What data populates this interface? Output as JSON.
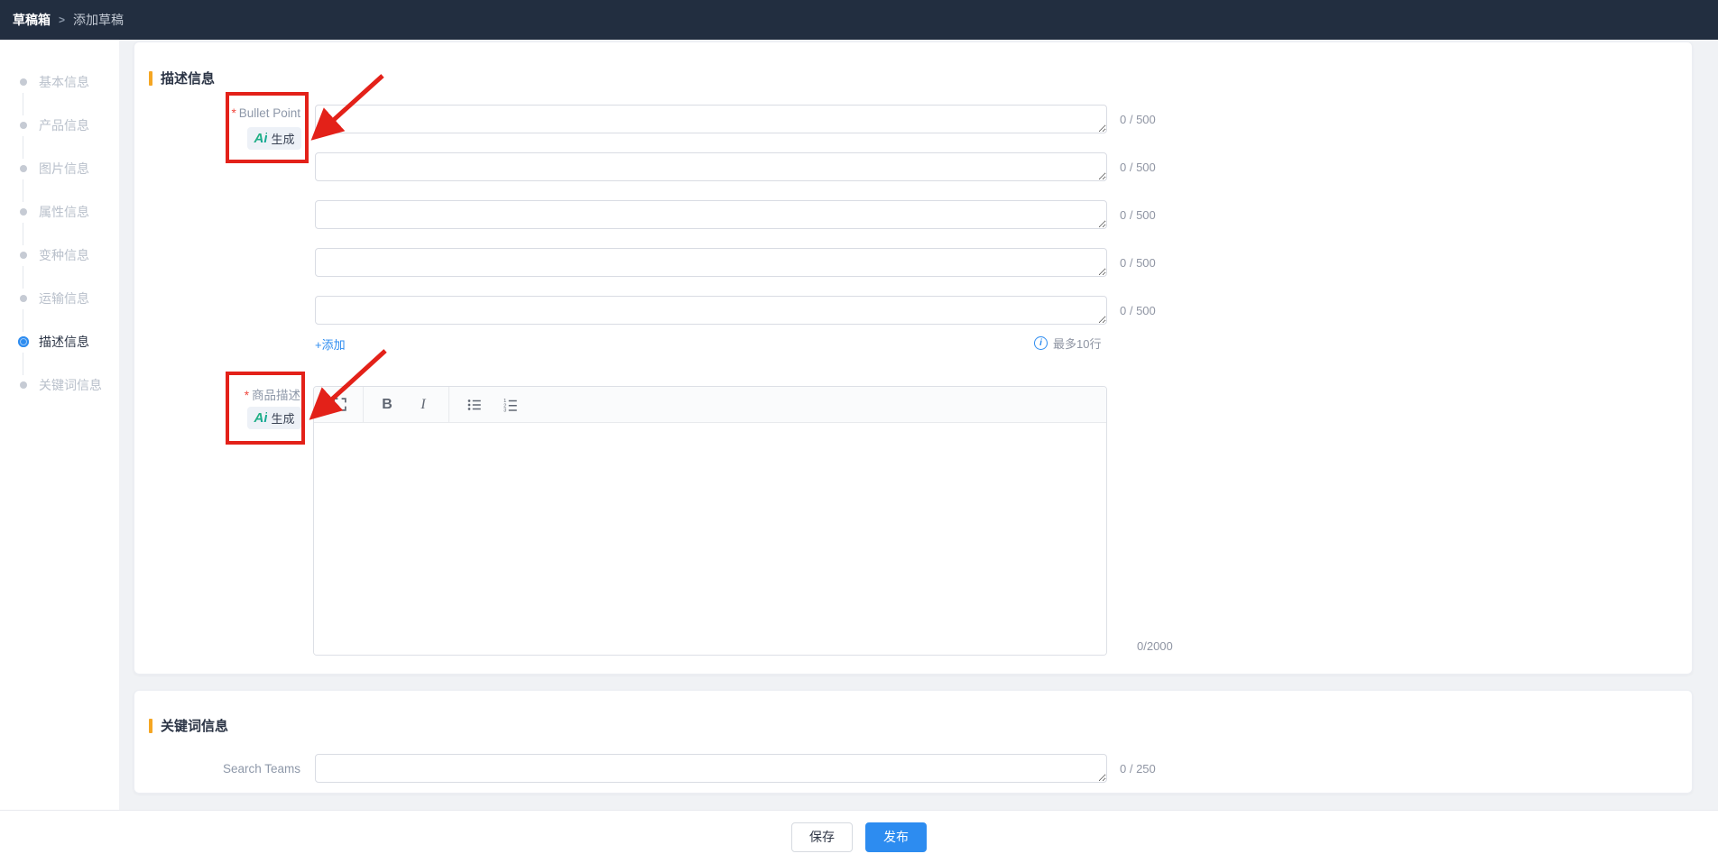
{
  "topbar": {
    "breadcrumb": {
      "root": "草稿箱",
      "separator": ">",
      "current": "添加草稿"
    }
  },
  "sidebar": {
    "items": [
      {
        "label": "基本信息",
        "active": false
      },
      {
        "label": "产品信息",
        "active": false
      },
      {
        "label": "图片信息",
        "active": false
      },
      {
        "label": "属性信息",
        "active": false
      },
      {
        "label": "变种信息",
        "active": false
      },
      {
        "label": "运输信息",
        "active": false
      },
      {
        "label": "描述信息",
        "active": true
      },
      {
        "label": "关键词信息",
        "active": false
      }
    ]
  },
  "description_section": {
    "title": "描述信息",
    "bullet_point": {
      "required_mark": "*",
      "label": "Bullet Point",
      "ai_logo": "Ai",
      "ai_button": "生成",
      "rows": [
        {
          "value": "",
          "counter": "0 / 500"
        },
        {
          "value": "",
          "counter": "0 / 500"
        },
        {
          "value": "",
          "counter": "0 / 500"
        },
        {
          "value": "",
          "counter": "0 / 500"
        },
        {
          "value": "",
          "counter": "0 / 500"
        }
      ],
      "add_link": "+添加",
      "info_icon_glyph": "i",
      "max_hint": "最多10行"
    },
    "product_desc": {
      "required_mark": "*",
      "label": "商品描述",
      "ai_logo": "Ai",
      "ai_button": "生成",
      "toolbar": {
        "bold": "B",
        "italic": "I"
      },
      "value": "",
      "counter": "0/2000"
    }
  },
  "keywords_section": {
    "title": "关键词信息",
    "search_terms": {
      "label": "Search Teams",
      "value": "",
      "counter": "0 / 250"
    }
  },
  "footer": {
    "save_label": "保存",
    "publish_label": "发布"
  },
  "colors": {
    "topbar_bg": "#222e40",
    "accent_orange": "#f5a623",
    "primary_blue": "#2d8cf0",
    "ai_teal": "#14a88d",
    "annotation_red": "#e32119"
  }
}
